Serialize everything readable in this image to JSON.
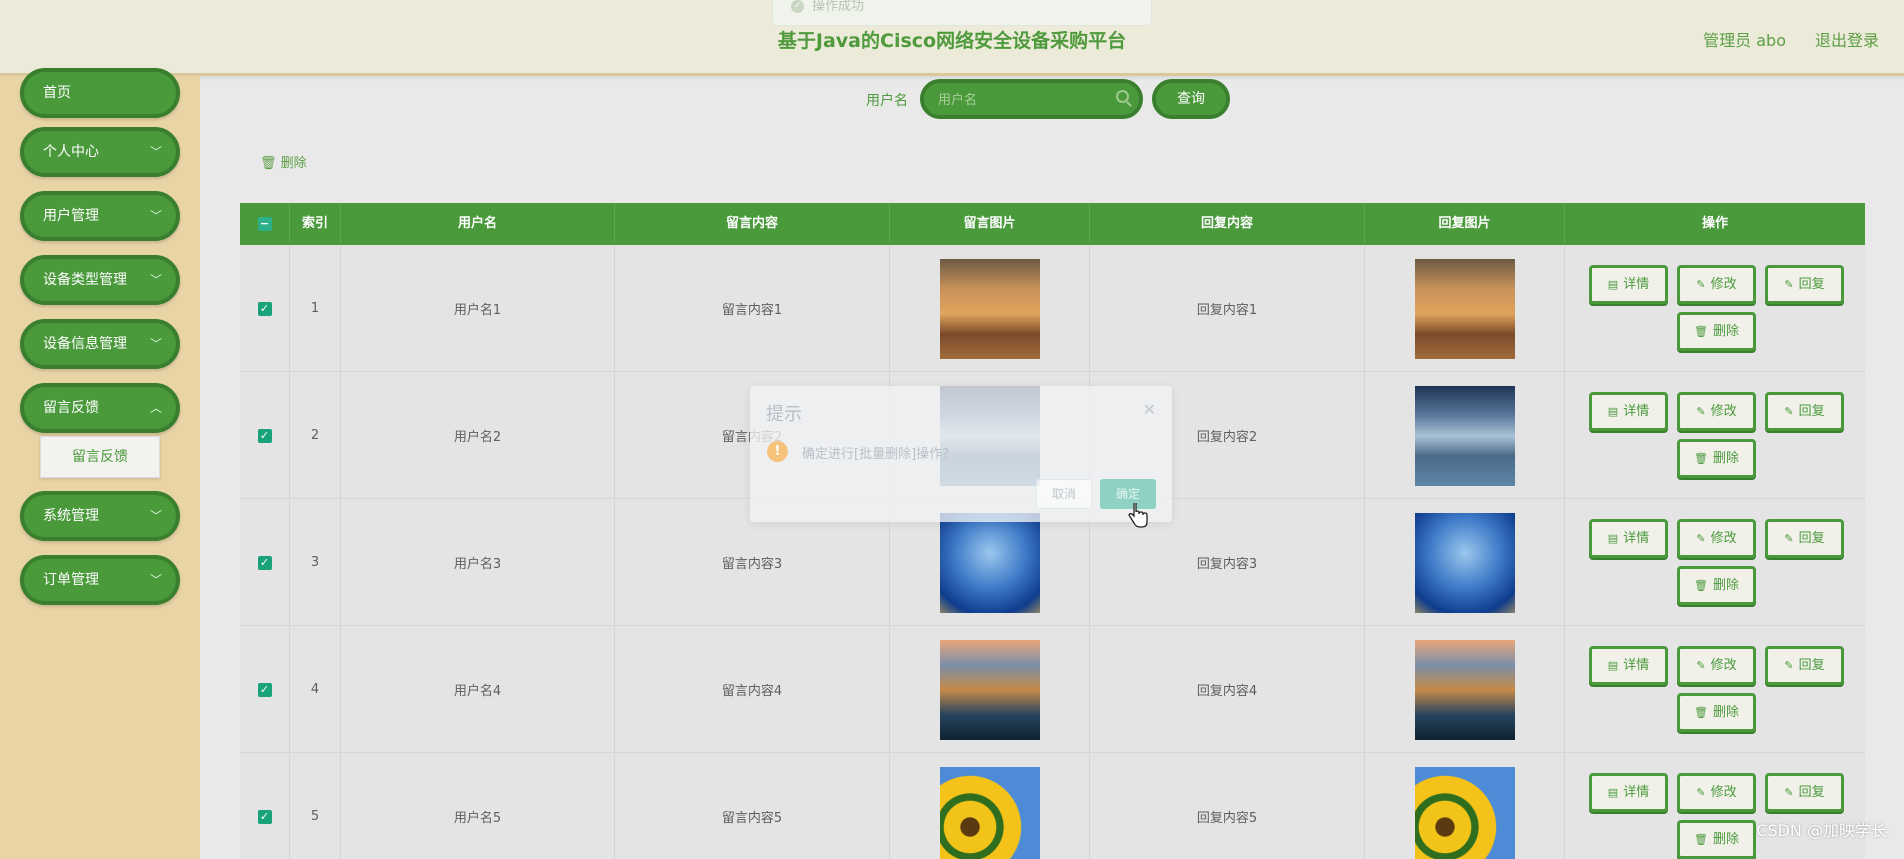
{
  "header": {
    "title": "基于Java的Cisco网络安全设备采购平台",
    "admin_label": "管理员 abo",
    "logout_label": "退出登录",
    "toast": "操作成功"
  },
  "sidebar": {
    "items": [
      {
        "label": "首页"
      },
      {
        "label": "个人中心"
      },
      {
        "label": "用户管理"
      },
      {
        "label": "设备类型管理"
      },
      {
        "label": "设备信息管理"
      },
      {
        "label": "留言反馈"
      },
      {
        "label": "系统管理"
      },
      {
        "label": "订单管理"
      }
    ],
    "submenu": {
      "label": "留言反馈"
    }
  },
  "search": {
    "label": "用户名",
    "placeholder": "用户名",
    "button": "查询"
  },
  "toolbar": {
    "delete_label": "删除"
  },
  "table": {
    "headers": [
      "索引",
      "用户名",
      "留言内容",
      "留言图片",
      "回复内容",
      "回复图片",
      "操作"
    ],
    "rows": [
      {
        "index": "1",
        "username": "用户名1",
        "message": "留言内容1",
        "reply": "回复内容1"
      },
      {
        "index": "2",
        "username": "用户名2",
        "message": "留言内容2",
        "reply": "回复内容2"
      },
      {
        "index": "3",
        "username": "用户名3",
        "message": "留言内容3",
        "reply": "回复内容3"
      },
      {
        "index": "4",
        "username": "用户名4",
        "message": "留言内容4",
        "reply": "回复内容4"
      },
      {
        "index": "5",
        "username": "用户名5",
        "message": "留言内容5",
        "reply": "回复内容5"
      }
    ],
    "actions": {
      "detail": "详情",
      "edit": "修改",
      "reply": "回复",
      "delete": "删除"
    }
  },
  "modal": {
    "title": "提示",
    "message": "确定进行[批量删除]操作?",
    "cancel": "取消",
    "confirm": "确定"
  },
  "watermark": "CSDN @加映学长",
  "colors": {
    "accent": "#4a9a3c",
    "sidebar_bg": "#e9d4a6",
    "header_bg": "#ecebd9",
    "checkbox": "#1aa37a"
  }
}
